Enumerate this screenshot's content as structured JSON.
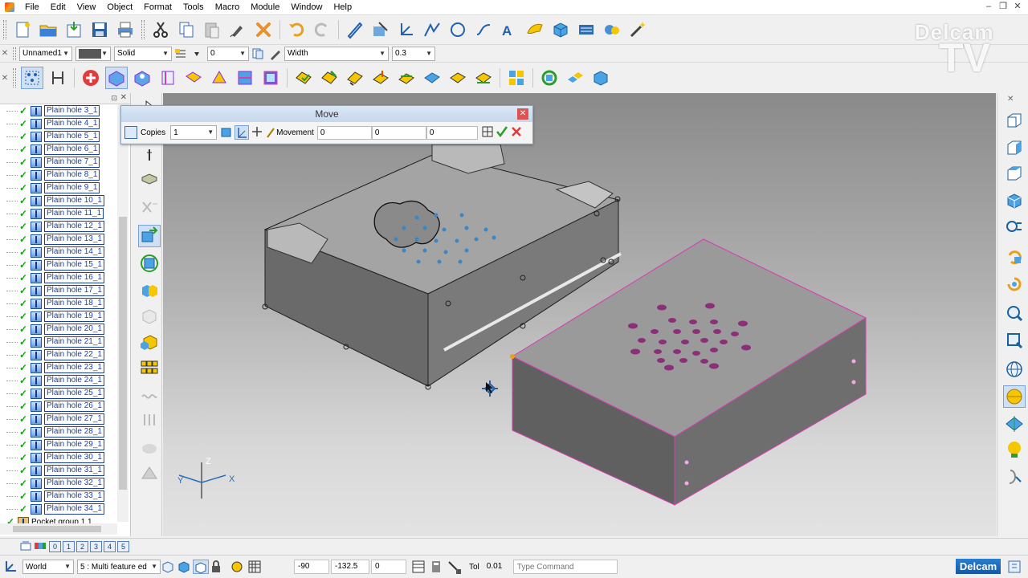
{
  "menu": [
    "File",
    "Edit",
    "View",
    "Object",
    "Format",
    "Tools",
    "Macro",
    "Module",
    "Window",
    "Help"
  ],
  "format_bar": {
    "object_name": "Unnamed1",
    "style": "Solid",
    "thickness": "0",
    "width_label": "Width",
    "width_value": "0.3"
  },
  "tree": {
    "items": [
      "Plain hole 3_1",
      "Plain hole 4_1",
      "Plain hole 5_1",
      "Plain hole 6_1",
      "Plain hole 7_1",
      "Plain hole 8_1",
      "Plain hole 9_1",
      "Plain hole 10_1",
      "Plain hole 11_1",
      "Plain hole 12_1",
      "Plain hole 13_1",
      "Plain hole 14_1",
      "Plain hole 15_1",
      "Plain hole 16_1",
      "Plain hole 17_1",
      "Plain hole 18_1",
      "Plain hole 19_1",
      "Plain hole 20_1",
      "Plain hole 21_1",
      "Plain hole 22_1",
      "Plain hole 23_1",
      "Plain hole 24_1",
      "Plain hole 25_1",
      "Plain hole 26_1",
      "Plain hole 27_1",
      "Plain hole 28_1",
      "Plain hole 29_1",
      "Plain hole 30_1",
      "Plain hole 31_1",
      "Plain hole 32_1",
      "Plain hole 33_1",
      "Plain hole 34_1"
    ],
    "last_item": "Pocket group 1 1"
  },
  "move_dialog": {
    "title": "Move",
    "copies_label": "Copies",
    "copies_value": "1",
    "movement_label": "Movement",
    "x": "0",
    "y": "0",
    "z": "0"
  },
  "axes": {
    "x": "X",
    "y": "Y",
    "z": "Z"
  },
  "layers": [
    "0",
    "1",
    "2",
    "3",
    "4",
    "5"
  ],
  "status": {
    "workplane": "World",
    "filter": "5 : Multi feature ed",
    "coord_x": "-90",
    "coord_y": "-132.5",
    "coord_z": "0",
    "tol_label": "Tol",
    "tol_value": "0.01",
    "command_placeholder": "Type Command",
    "brand_button": "Delcam"
  },
  "watermark": {
    "line1": "Delcam",
    "line2": "TV"
  },
  "colors": {
    "accent": "#1a3fa6",
    "selection": "#d63fb0",
    "hole_blue": "#3a86c9"
  }
}
